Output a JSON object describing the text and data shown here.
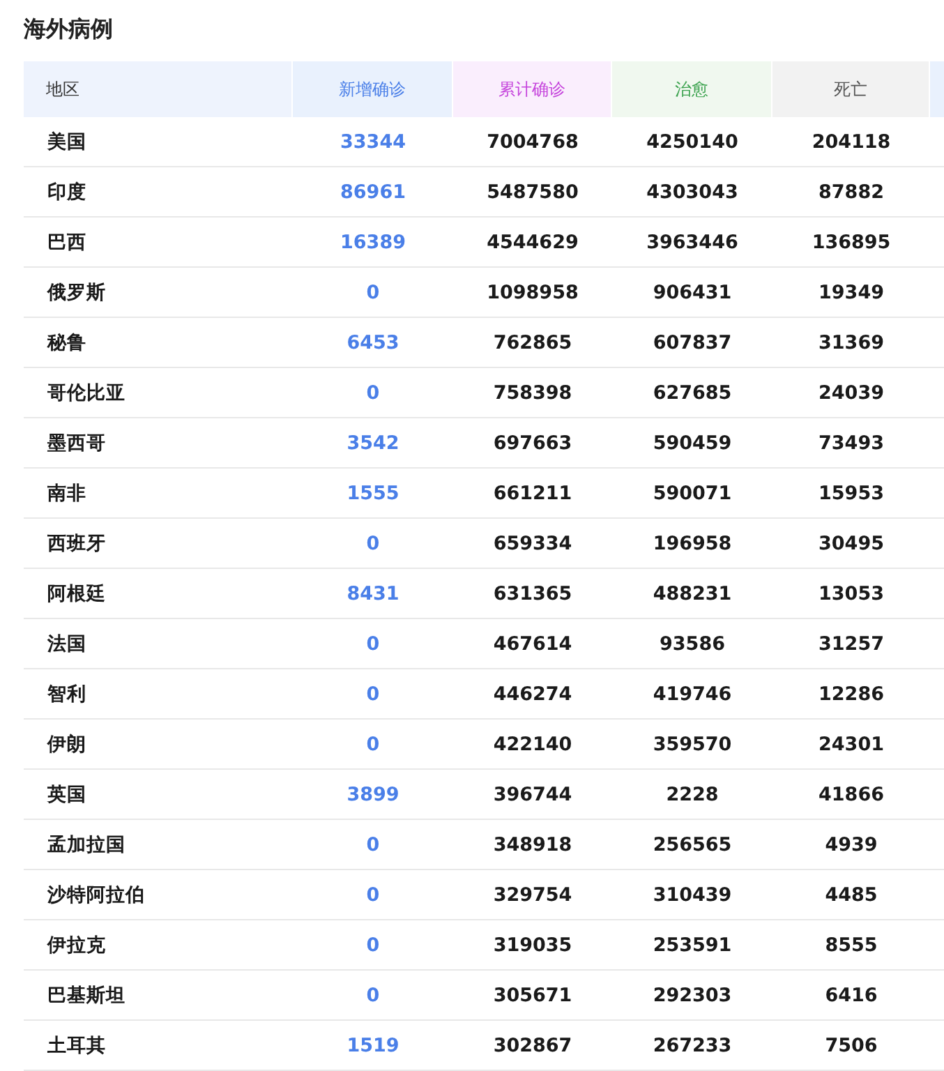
{
  "title": "海外病例",
  "table": {
    "columns": [
      {
        "label": "地区",
        "color": "#333333"
      },
      {
        "label": "新增确诊",
        "color": "#4a7fe8"
      },
      {
        "label": "累计确诊",
        "color": "#c544dc"
      },
      {
        "label": "治愈",
        "color": "#3ba24e"
      },
      {
        "label": "死亡",
        "color": "#555555"
      }
    ],
    "rows": [
      [
        "美国",
        "33344",
        "7004768",
        "4250140",
        "204118"
      ],
      [
        "印度",
        "86961",
        "5487580",
        "4303043",
        "87882"
      ],
      [
        "巴西",
        "16389",
        "4544629",
        "3963446",
        "136895"
      ],
      [
        "俄罗斯",
        "0",
        "1098958",
        "906431",
        "19349"
      ],
      [
        "秘鲁",
        "6453",
        "762865",
        "607837",
        "31369"
      ],
      [
        "哥伦比亚",
        "0",
        "758398",
        "627685",
        "24039"
      ],
      [
        "墨西哥",
        "3542",
        "697663",
        "590459",
        "73493"
      ],
      [
        "南非",
        "1555",
        "661211",
        "590071",
        "15953"
      ],
      [
        "西班牙",
        "0",
        "659334",
        "196958",
        "30495"
      ],
      [
        "阿根廷",
        "8431",
        "631365",
        "488231",
        "13053"
      ],
      [
        "法国",
        "0",
        "467614",
        "93586",
        "31257"
      ],
      [
        "智利",
        "0",
        "446274",
        "419746",
        "12286"
      ],
      [
        "伊朗",
        "0",
        "422140",
        "359570",
        "24301"
      ],
      [
        "英国",
        "3899",
        "396744",
        "2228",
        "41866"
      ],
      [
        "孟加拉国",
        "0",
        "348918",
        "256565",
        "4939"
      ],
      [
        "沙特阿拉伯",
        "0",
        "329754",
        "310439",
        "4485"
      ],
      [
        "伊拉克",
        "0",
        "319035",
        "253591",
        "8555"
      ],
      [
        "巴基斯坦",
        "0",
        "305671",
        "292303",
        "6416"
      ],
      [
        "土耳其",
        "1519",
        "302867",
        "267233",
        "7506"
      ]
    ]
  }
}
